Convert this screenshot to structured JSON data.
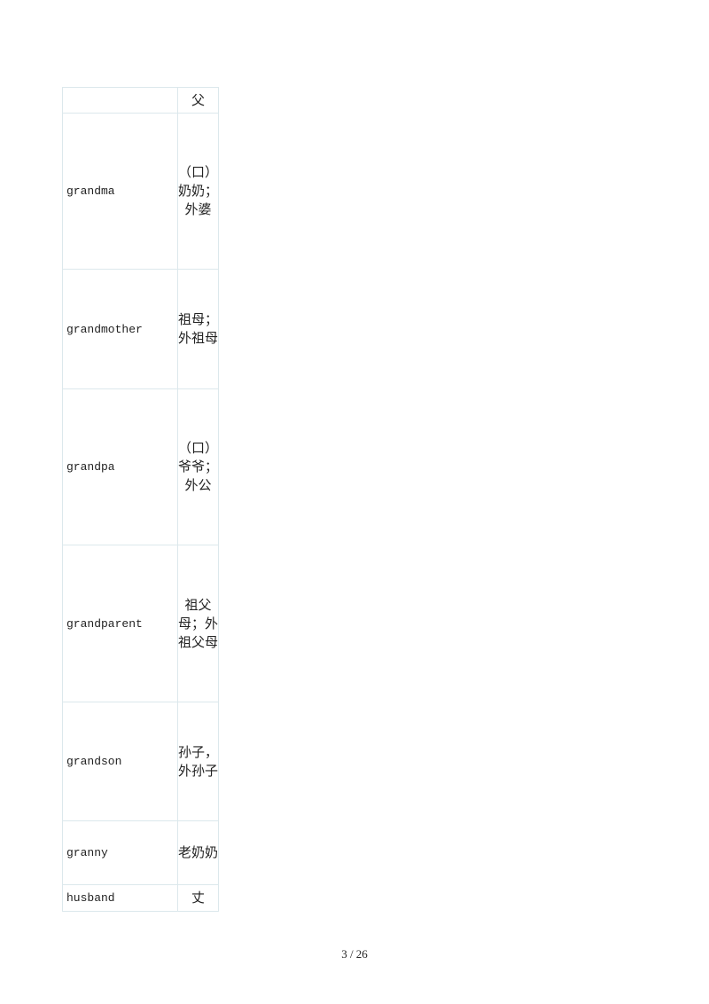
{
  "rows": [
    {
      "word": "",
      "meaning": "父"
    },
    {
      "word": "grandma",
      "meaning": "（口）奶奶；外婆"
    },
    {
      "word": "grandmother",
      "meaning": "祖母；外祖母"
    },
    {
      "word": "grandpa",
      "meaning": "（口）爷爷；外公"
    },
    {
      "word": "grandparent",
      "meaning": "祖父母；外祖父母"
    },
    {
      "word": "grandson",
      "meaning": "孙子，外孙子"
    },
    {
      "word": "granny",
      "meaning": "老奶奶"
    },
    {
      "word": "husband",
      "meaning": "丈"
    }
  ],
  "footer": {
    "page": "3 / 26"
  }
}
